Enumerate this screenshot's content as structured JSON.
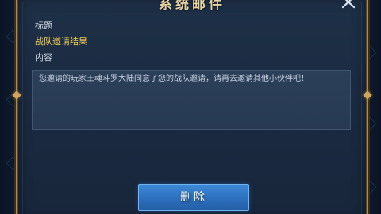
{
  "dialog": {
    "title": "系统邮件",
    "close_icon": "close-x-icon"
  },
  "mail": {
    "subject_label": "标题",
    "subject_value": "战队邀请结果",
    "content_label": "内容",
    "content_text": "您邀请的玩家王魂斗罗大陆同意了您的战队邀请，请再去邀请其他小伙伴吧！"
  },
  "actions": {
    "delete_label": "删除"
  },
  "colors": {
    "frame_gold": "#b08a4a",
    "subject_yellow": "#f2cf57",
    "button_blue": "#2c6fbd",
    "panel_navy": "#1b2b42"
  }
}
